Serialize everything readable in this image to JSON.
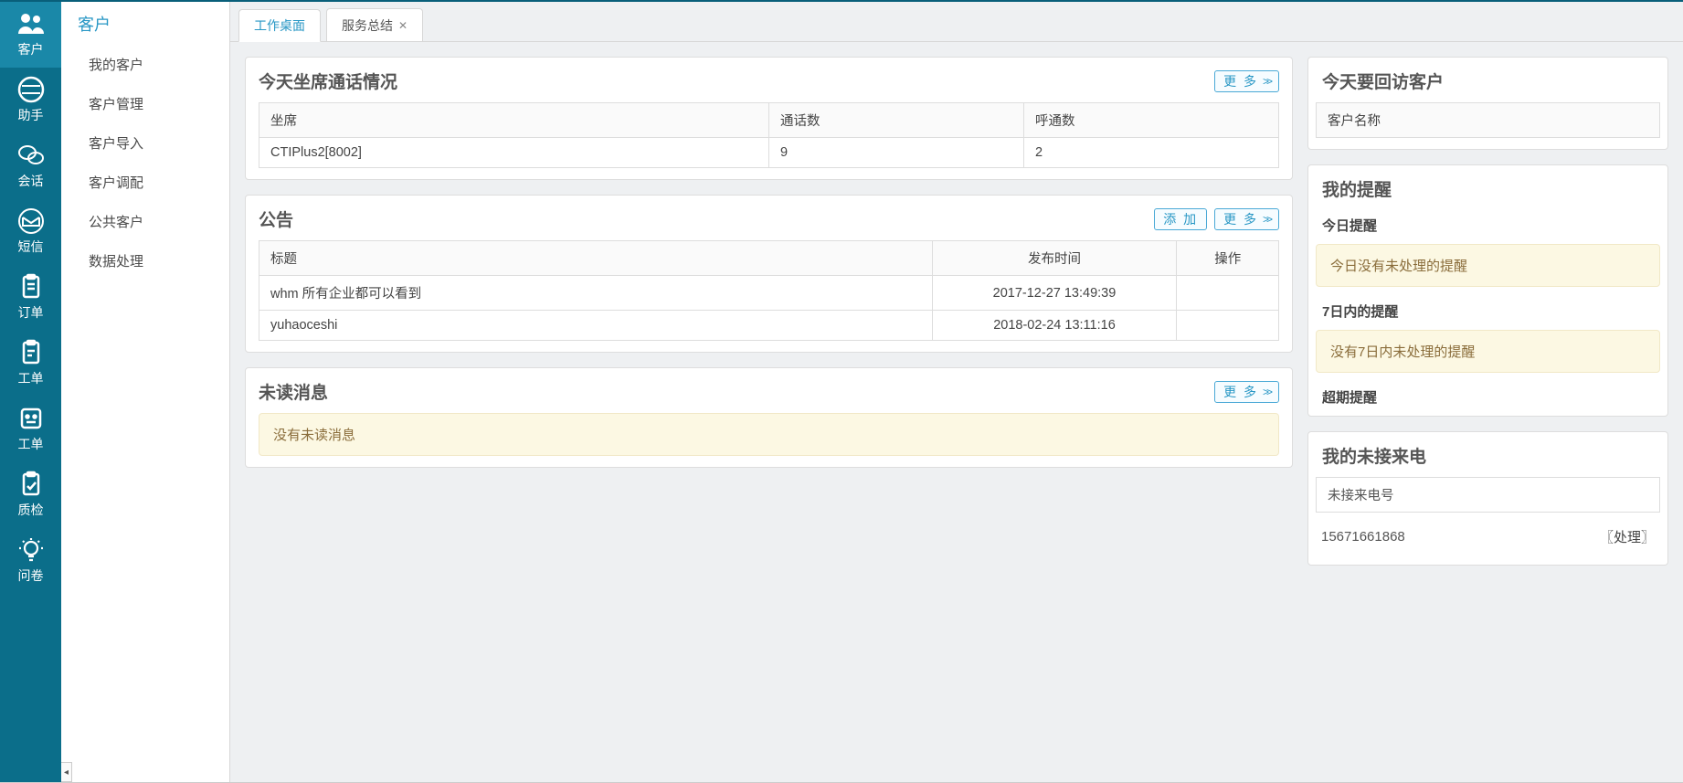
{
  "nav": {
    "items": [
      {
        "icon": "users",
        "label": "客户"
      },
      {
        "icon": "assistant",
        "label": "助手"
      },
      {
        "icon": "wechat",
        "label": "会话"
      },
      {
        "icon": "mail",
        "label": "短信"
      },
      {
        "icon": "clipboard",
        "label": "订单"
      },
      {
        "icon": "clipboard2",
        "label": "工单"
      },
      {
        "icon": "face",
        "label": "工单"
      },
      {
        "icon": "clipcheck",
        "label": "质检"
      },
      {
        "icon": "bulb",
        "label": "问卷"
      }
    ],
    "activeIndex": 0
  },
  "submenu": {
    "title": "客户",
    "items": [
      "我的客户",
      "客户管理",
      "客户导入",
      "客户调配",
      "公共客户",
      "数据处理"
    ]
  },
  "tabs": [
    {
      "label": "工作桌面",
      "active": true,
      "closable": false
    },
    {
      "label": "服务总结",
      "active": false,
      "closable": true
    }
  ],
  "buttons": {
    "more": "更 多",
    "add": "添   加",
    "arrows": ">>"
  },
  "panels": {
    "agentCalls": {
      "title": "今天坐席通话情况",
      "headers": [
        "坐席",
        "通话数",
        "呼通数"
      ],
      "row": {
        "agent": "CTIPlus2[8002]",
        "calls": "9",
        "connected": "2"
      }
    },
    "announce": {
      "title": "公告",
      "headers": {
        "title": "标题",
        "time": "发布时间",
        "op": "操作"
      },
      "rows": [
        {
          "title": "whm 所有企业都可以看到",
          "time": "2017-12-27 13:49:39"
        },
        {
          "title": "yuhaoceshi",
          "time": "2018-02-24 13:11:16"
        }
      ]
    },
    "unread": {
      "title": "未读消息",
      "empty": "没有未读消息"
    },
    "callback": {
      "title": "今天要回访客户",
      "header": "客户名称"
    },
    "reminders": {
      "title": "我的提醒",
      "today": {
        "header": "今日提醒",
        "msg": "今日没有未处理的提醒"
      },
      "sevenDay": {
        "header": "7日内的提醒",
        "msg": "没有7日内未处理的提醒"
      },
      "overdue": {
        "header": "超期提醒"
      }
    },
    "missed": {
      "title": "我的未接来电",
      "header": "未接来电号",
      "number": "15671661868",
      "action": "〖处理〗"
    }
  }
}
